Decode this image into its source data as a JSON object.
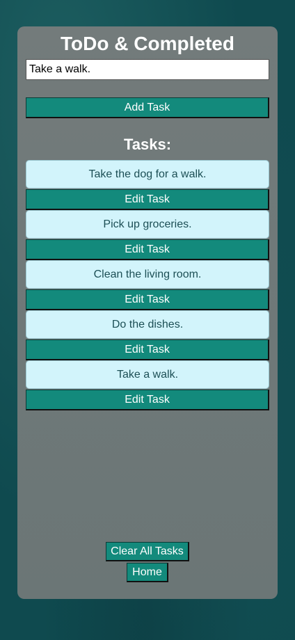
{
  "app": {
    "title": "ToDo & Completed"
  },
  "input": {
    "value": "Take a walk."
  },
  "buttons": {
    "add": "Add Task",
    "edit": "Edit Task",
    "clear_all": "Clear All Tasks",
    "home": "Home"
  },
  "tasks_heading": "Tasks:",
  "tasks": [
    {
      "text": "Take the dog for a walk."
    },
    {
      "text": "Pick up groceries."
    },
    {
      "text": "Clean the living room."
    },
    {
      "text": "Do the dishes."
    },
    {
      "text": "Take a walk."
    }
  ],
  "colors": {
    "background": "#0f4a4f",
    "panel": "#737b7b",
    "button": "#138a7c",
    "task_card": "#d2f4fb",
    "task_text": "#1c4f55"
  }
}
